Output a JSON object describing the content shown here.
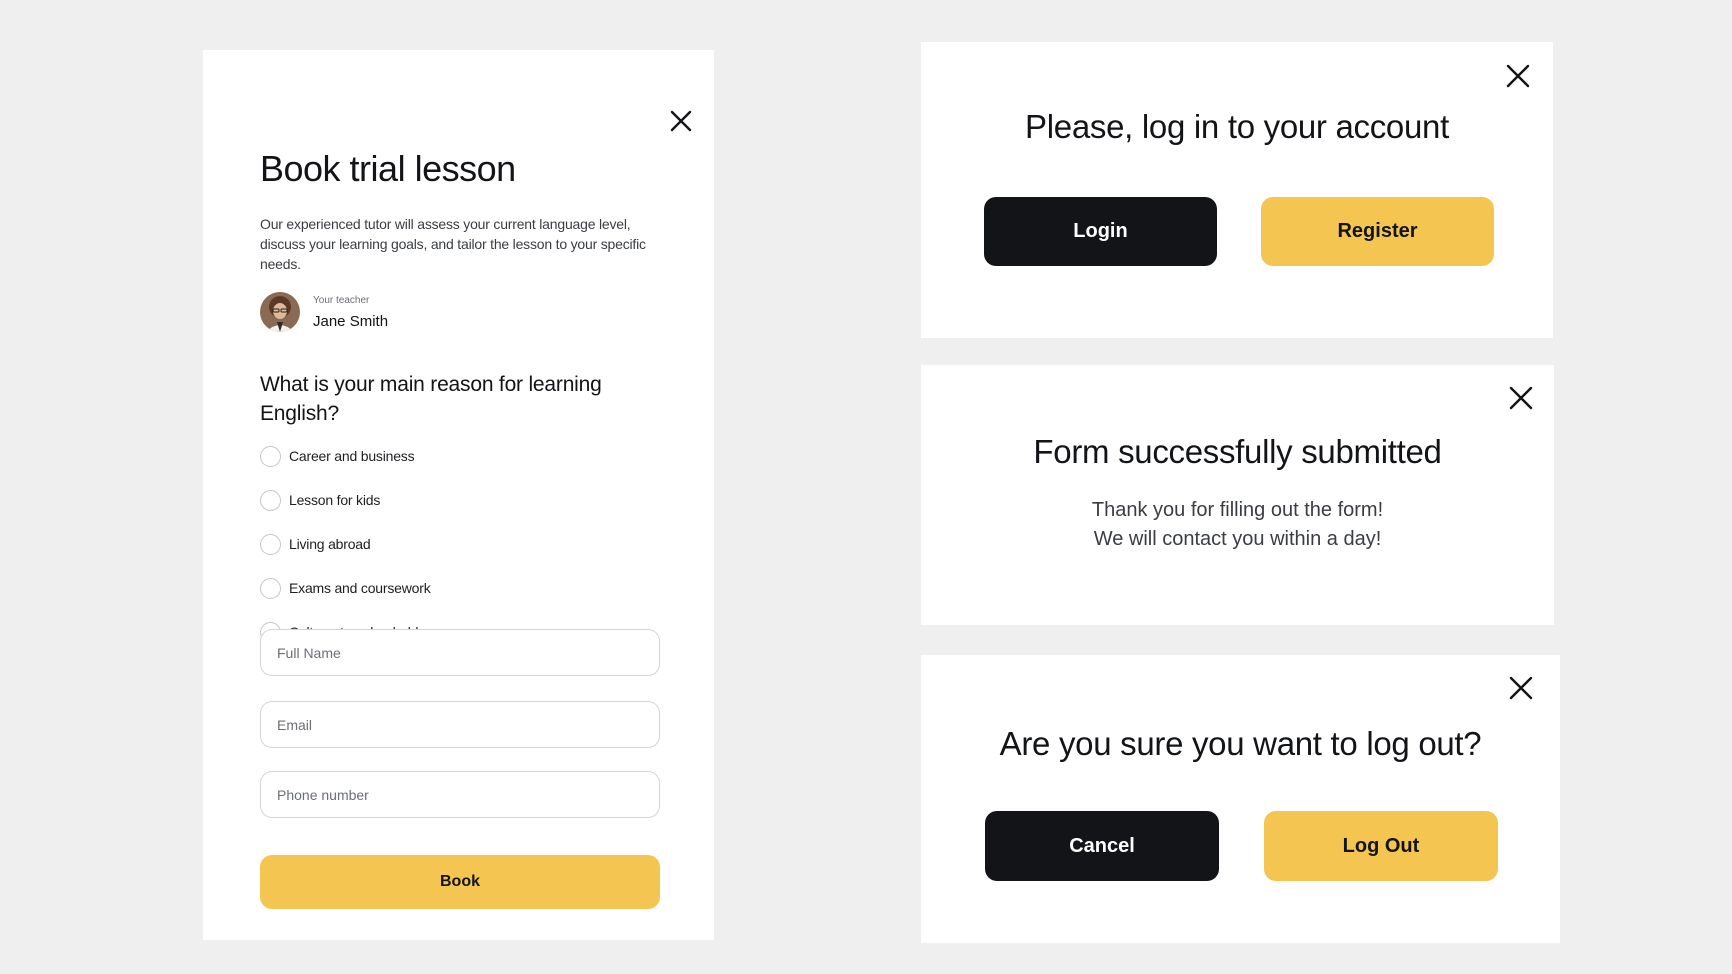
{
  "booking": {
    "title": "Book trial lesson",
    "description": "Our experienced tutor will assess your current language level, discuss your learning goals, and tailor the lesson to your specific needs.",
    "teacher_caption": "Your teacher",
    "teacher_name": "Jane Smith",
    "question": "What is your main reason for learning English?",
    "options": [
      {
        "label": "Career and business"
      },
      {
        "label": "Lesson for kids"
      },
      {
        "label": "Living abroad"
      },
      {
        "label": "Exams and coursework"
      },
      {
        "label": "Culture, travel or hobby"
      }
    ],
    "fields": {
      "full_name_placeholder": "Full Name",
      "email_placeholder": "Email",
      "phone_placeholder": "Phone number"
    },
    "book_label": "Book",
    "close_icon": "close-icon"
  },
  "login_modal": {
    "title": "Please, log in to your account",
    "login_label": "Login",
    "register_label": "Register"
  },
  "success_modal": {
    "title": "Form successfully submitted",
    "line1": "Thank you for filling out the form!",
    "line2": "We will contact you within a day!"
  },
  "logout_modal": {
    "title": "Are you sure you want to log out?",
    "cancel_label": "Cancel",
    "logout_label": "Log Out"
  },
  "colors": {
    "accent": "#f4c550",
    "dark": "#121417",
    "background": "#efefef",
    "card": "#ffffff"
  }
}
